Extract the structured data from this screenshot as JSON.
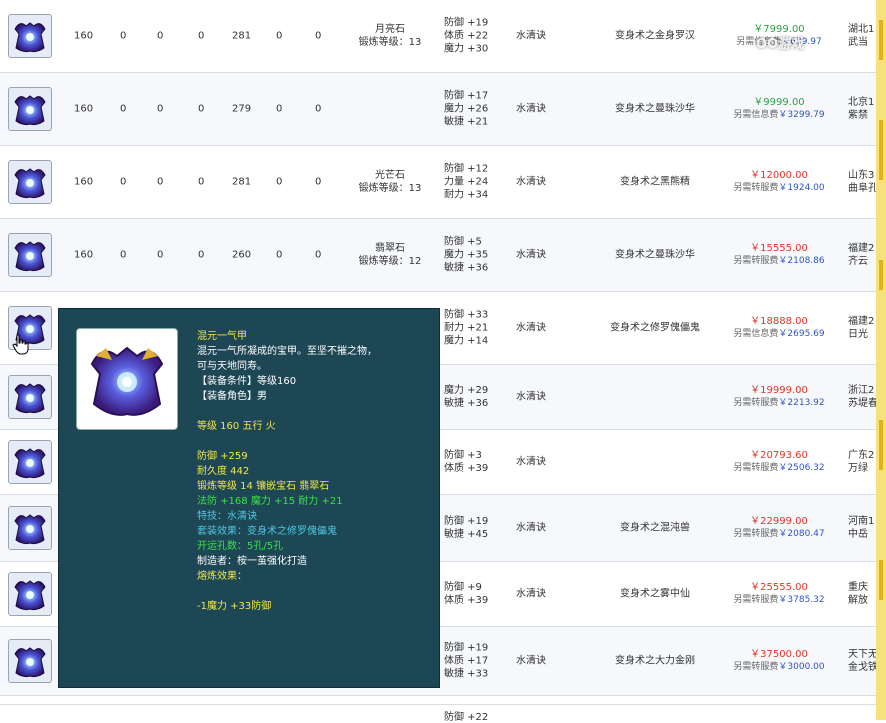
{
  "rows": [
    {
      "lvl": "160",
      "a": "0",
      "b": "0",
      "c": "0",
      "d": "281",
      "e": "0",
      "f": "0",
      "gem": "月亮石",
      "gem_sub": "锻炼等级：13",
      "attrs": [
        "防御 +19",
        "体质 +22",
        "魔力 +30"
      ],
      "skill": "水清诀",
      "effect": "变身术之金身罗汉",
      "price": "￥7999.00",
      "price_color": "green",
      "fee_label": "另需信息费",
      "fee": "￥679.97",
      "server1": "湖北1",
      "server2": "武当"
    },
    {
      "lvl": "160",
      "a": "0",
      "b": "0",
      "c": "0",
      "d": "279",
      "e": "0",
      "f": "0",
      "gem": "",
      "gem_sub": "",
      "attrs": [
        "防御 +17",
        "魔力 +26",
        "敏捷 +21"
      ],
      "skill": "水清诀",
      "effect": "变身术之曼珠沙华",
      "price": "￥9999.00",
      "price_color": "green",
      "fee_label": "另需信息费",
      "fee": "￥3299.79",
      "server1": "北京1",
      "server2": "紫禁"
    },
    {
      "lvl": "160",
      "a": "0",
      "b": "0",
      "c": "0",
      "d": "281",
      "e": "0",
      "f": "0",
      "gem": "光芒石",
      "gem_sub": "锻炼等级：13",
      "attrs": [
        "防御 +12",
        "力量 +24",
        "耐力 +34"
      ],
      "skill": "水清诀",
      "effect": "变身术之黑熊精",
      "price": "￥12000.00",
      "price_color": "red",
      "fee_label": "另需转服费",
      "fee": "￥1924.00",
      "server1": "山东3",
      "server2": "曲阜孔"
    },
    {
      "lvl": "160",
      "a": "0",
      "b": "0",
      "c": "0",
      "d": "260",
      "e": "0",
      "f": "0",
      "gem": "翡翠石",
      "gem_sub": "锻炼等级：12",
      "attrs": [
        "防御 +5",
        "魔力 +35",
        "敏捷 +36"
      ],
      "skill": "水清诀",
      "effect": "变身术之曼珠沙华",
      "price": "￥15555.00",
      "price_color": "red",
      "fee_label": "另需转服费",
      "fee": "￥2108.86",
      "server1": "福建2",
      "server2": "齐云"
    },
    {
      "lvl": "",
      "a": "",
      "b": "",
      "c": "",
      "d": "",
      "e": "",
      "f": "",
      "gem": "",
      "gem_sub": "",
      "attrs": [
        "防御 +33",
        "耐力 +21",
        "魔力 +14"
      ],
      "skill": "水清诀",
      "effect": "变身术之修罗傀儡鬼",
      "price": "￥18888.00",
      "price_color": "red",
      "fee_label": "另需信息费",
      "fee": "￥2695.69",
      "server1": "福建2",
      "server2": "日光"
    },
    {
      "lvl": "",
      "a": "",
      "b": "",
      "c": "",
      "d": "",
      "e": "",
      "f": "",
      "gem": "",
      "gem_sub": "",
      "attrs": [
        "魔力 +29",
        "敏捷 +36"
      ],
      "skill": "水清诀",
      "effect": "",
      "price": "￥19999.00",
      "price_color": "red",
      "fee_label": "另需转服费",
      "fee": "￥2213.92",
      "server1": "浙江2",
      "server2": "苏堤春"
    },
    {
      "lvl": "",
      "a": "",
      "b": "",
      "c": "",
      "d": "",
      "e": "",
      "f": "",
      "gem": "",
      "gem_sub": "",
      "attrs": [
        "防御 +3",
        "体质 +39"
      ],
      "skill": "水清诀",
      "effect": "",
      "price": "￥20793.60",
      "price_color": "red",
      "fee_label": "另需转服费",
      "fee": "￥2506.32",
      "server1": "广东2",
      "server2": "万绿"
    },
    {
      "lvl": "",
      "a": "",
      "b": "",
      "c": "",
      "d": "",
      "e": "",
      "f": "",
      "gem": "",
      "gem_sub": "",
      "attrs": [
        "防御 +19",
        "敏捷 +45"
      ],
      "skill": "水清诀",
      "effect": "变身术之混沌兽",
      "price": "￥22999.00",
      "price_color": "red",
      "fee_label": "另需转服费",
      "fee": "￥2080.47",
      "server1": "河南1",
      "server2": "中岳"
    },
    {
      "lvl": "",
      "a": "",
      "b": "",
      "c": "",
      "d": "",
      "e": "",
      "f": "",
      "gem": "",
      "gem_sub": "",
      "attrs": [
        "防御 +9",
        "体质 +39"
      ],
      "skill": "水清诀",
      "effect": "变身术之雾中仙",
      "price": "￥25555.00",
      "price_color": "red",
      "fee_label": "另需转服费",
      "fee": "￥3785.32",
      "server1": "重庆",
      "server2": "解放"
    },
    {
      "lvl": "",
      "a": "",
      "b": "",
      "c": "",
      "d": "",
      "e": "",
      "f": "",
      "gem": "",
      "gem_sub": "",
      "attrs": [
        "防御 +19",
        "体质 +17",
        "敏捷 +33"
      ],
      "skill": "水清诀",
      "effect": "变身术之大力金刚",
      "price": "￥37500.00",
      "price_color": "red",
      "fee_label": "另需转服费",
      "fee": "￥3000.00",
      "server1": "天下无",
      "server2": "金戈铁"
    }
  ],
  "bottom_partial": {
    "attr": "防御 +22"
  },
  "tooltip": {
    "name": "混元一气甲",
    "desc1": "混元一气所凝成的宝甲。至坚不摧之物，",
    "desc2": "可与天地同寿。",
    "req": "【装备条件】等级160",
    "role": "【装备角色】男",
    "level_line": "等级 160 五行 火",
    "defense": "防御 +259",
    "durability": "耐久度 442",
    "forge": "锻炼等级 14 镶嵌宝石 翡翠石",
    "bonus": "法防 +168 魔力 +15 耐力 +21",
    "skill": "特技：水清诀",
    "set": "套装效果：变身术之修罗傀儡鬼",
    "holes": "开运孔数：5孔/5孔",
    "maker": "制造者：桉一茧强化打造",
    "refine_title": "熔炼效果：",
    "refine": "-1魔力 +33防御"
  },
  "watermark": "OO游戏",
  "colors": {
    "price_red": "#e0342a",
    "price_green": "#2aa04a",
    "tooltip_bg": "#1e4756",
    "tt_yellow": "#f0e64a",
    "tt_green": "#39e04a",
    "tt_cyan": "#4fc7e0"
  }
}
